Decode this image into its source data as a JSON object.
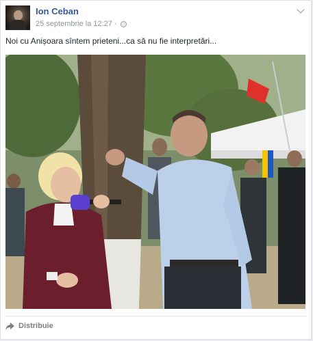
{
  "post": {
    "author": "Ion Ceban",
    "timestamp": "25 septembrie la 12:27",
    "privacy_icon": "globe-icon",
    "text": "Noi cu Anișoara sîntem prieteni...ca să nu fie interpretări...",
    "share_label": "Distribuie",
    "share_icon": "share-arrow-icon",
    "menu_icon": "chevron-down-icon"
  }
}
